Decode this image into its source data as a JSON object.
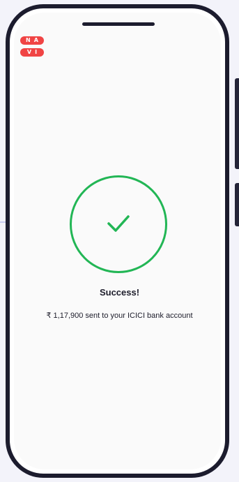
{
  "brand": {
    "logo_line1": "NA",
    "logo_line2": "VI",
    "logo_color": "#f04444"
  },
  "status": {
    "icon": "checkmark-icon",
    "accent_color": "#22b655",
    "title": "Success!",
    "message": "₹ 1,17,900 sent to your ICICI bank account"
  }
}
